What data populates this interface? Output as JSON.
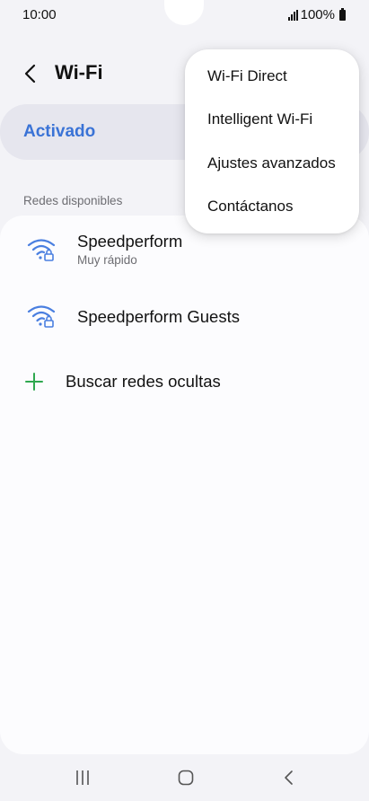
{
  "status_bar": {
    "time": "10:00",
    "battery": "100%"
  },
  "header": {
    "title": "Wi-Fi"
  },
  "toggle": {
    "label": "Activado"
  },
  "section": {
    "available_label": "Redes disponibles"
  },
  "networks": [
    {
      "name": "Speedperform",
      "subtitle": "Muy rápido",
      "icon": "wifi-lock-icon"
    },
    {
      "name": "Speedperform Guests",
      "icon": "wifi-lock-icon"
    }
  ],
  "add_hidden": {
    "label": "Buscar redes ocultas"
  },
  "menu": {
    "items": [
      {
        "label": "Wi-Fi Direct"
      },
      {
        "label": "Intelligent Wi-Fi"
      },
      {
        "label": "Ajustes avanzados"
      },
      {
        "label": "Contáctanos"
      }
    ]
  },
  "colors": {
    "accent": "#3a73d6",
    "wifi_icon": "#4a7fe0",
    "add_icon": "#2fa84f",
    "background": "#f3f3f7"
  }
}
